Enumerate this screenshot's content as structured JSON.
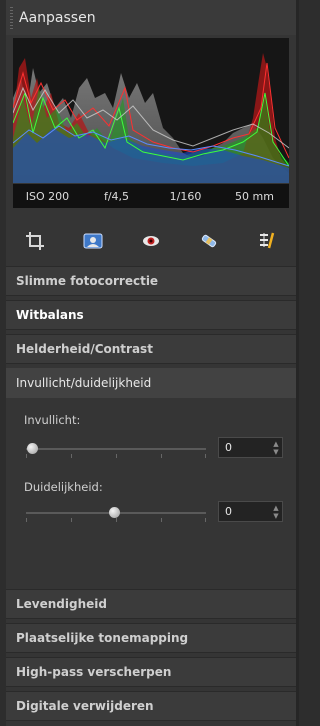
{
  "panel": {
    "title": "Aanpassen"
  },
  "exif": {
    "iso": "ISO 200",
    "aperture": "f/4,5",
    "shutter": "1/160",
    "focal": "50 mm"
  },
  "tools": [
    {
      "icon": "crop-icon"
    },
    {
      "icon": "photo-icon"
    },
    {
      "icon": "red-eye-icon"
    },
    {
      "icon": "retouch-brush-icon"
    },
    {
      "icon": "adjust-levels-icon"
    }
  ],
  "sections": {
    "slimme": "Slimme fotocorrectie",
    "witbalans": "Witbalans",
    "helderheid": "Helderheid/Contrast",
    "invullicht": "Invullicht/duidelijkheid",
    "levendigheid": "Levendigheid",
    "tonemapping": "Plaatselijke tonemapping",
    "highpass": "High-pass verscherpen",
    "digitale": "Digitale verwijderen"
  },
  "controls": {
    "invullicht_label": "Invullicht:",
    "invullicht_value": "0",
    "duidelijkheid_label": "Duidelijkheid:",
    "duidelijkheid_value": "0"
  }
}
